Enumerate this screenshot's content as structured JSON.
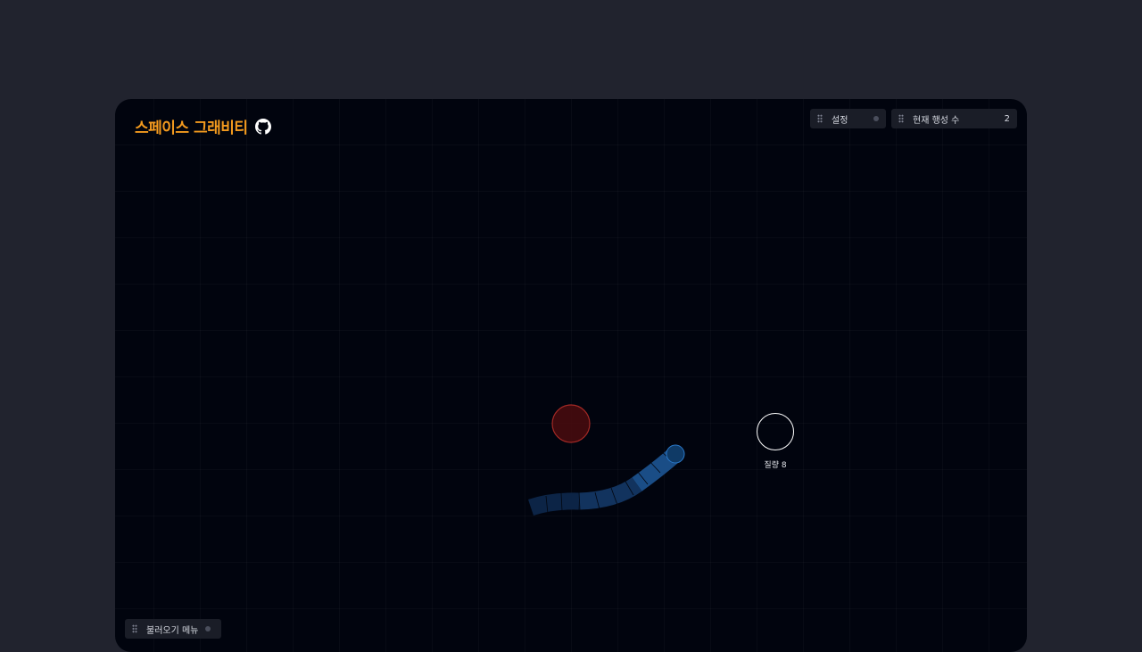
{
  "app": {
    "title": "스페이스 그래비티",
    "github_icon": "github-icon"
  },
  "panels": {
    "settings": {
      "label": "설정"
    },
    "planet_count": {
      "label": "현재 행성 수",
      "value": "2"
    },
    "load_menu": {
      "label": "불러오기 메뉴"
    }
  },
  "scene": {
    "star_color": "#7a1414",
    "trail_color": "#1d5fa3",
    "planet_color": "#0f3a66",
    "preview_planet": {
      "mass_label": "질량 8"
    }
  },
  "colors": {
    "accent": "#f39a1e",
    "background": "#01040e",
    "panel": "#1a1d27"
  }
}
